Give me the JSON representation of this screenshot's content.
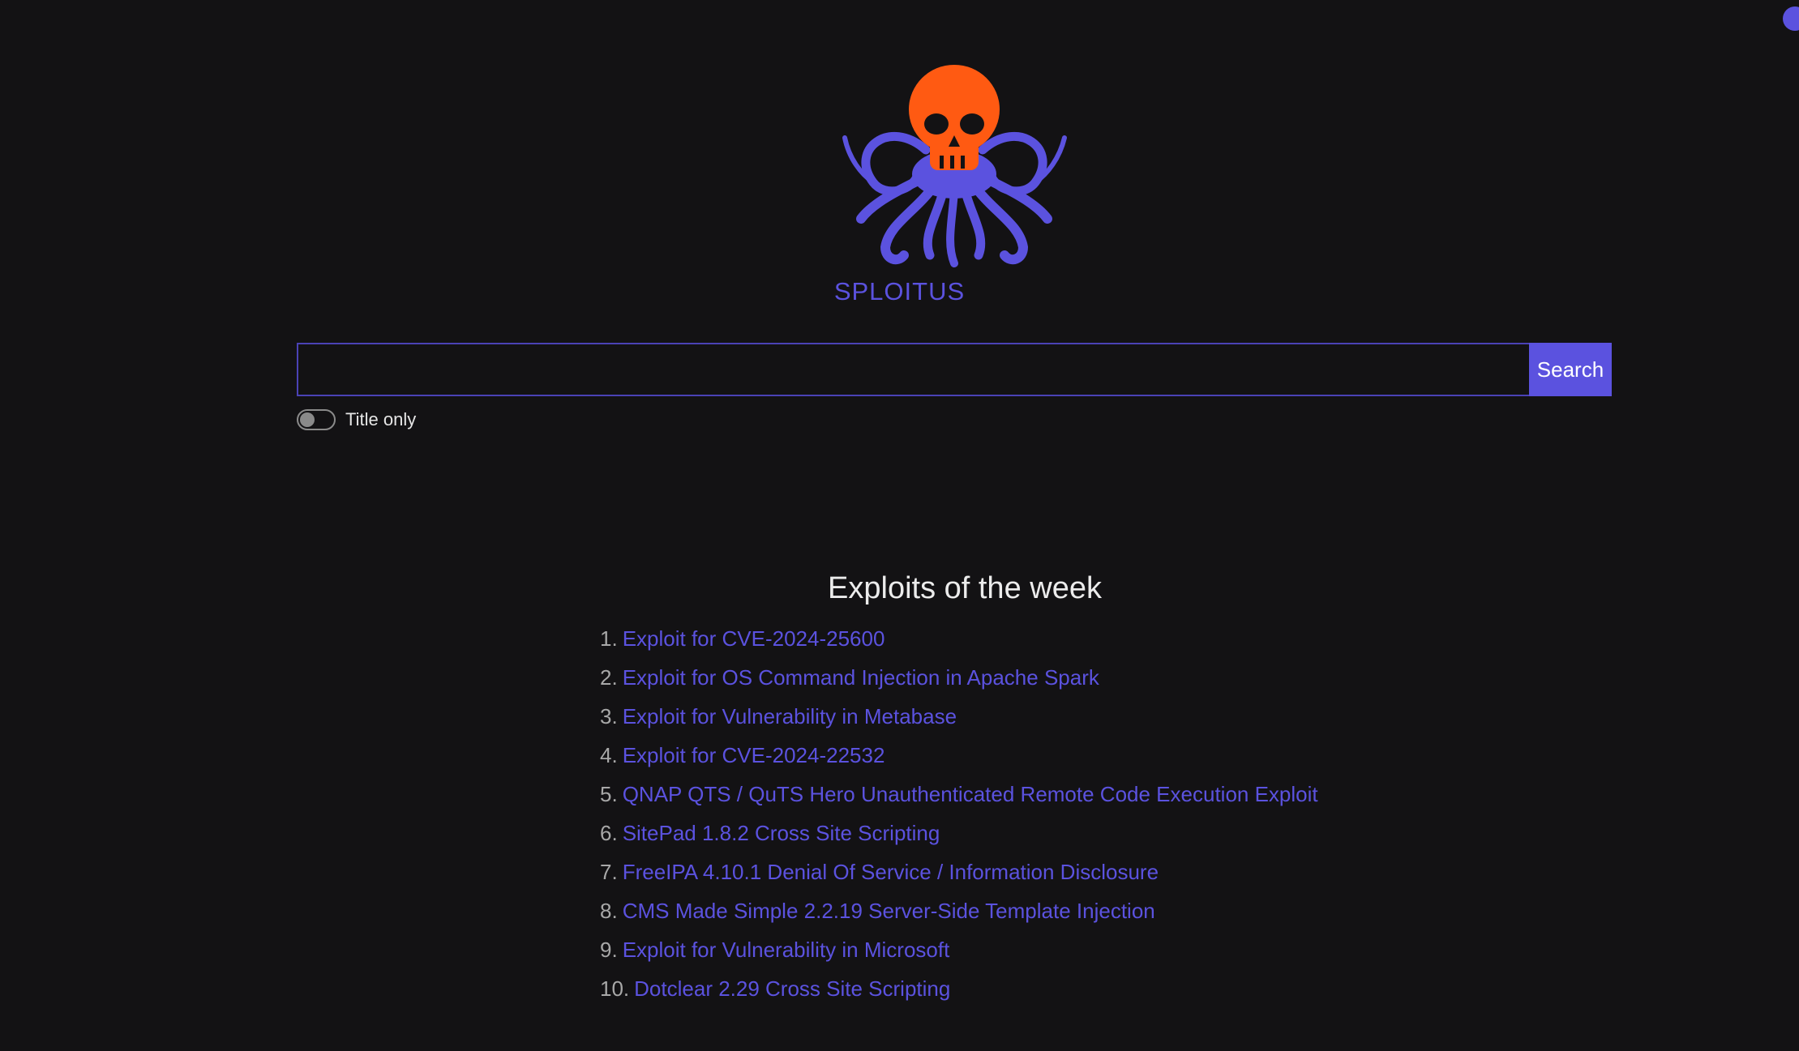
{
  "brand": {
    "name": "SPLOITUS",
    "accent_color": "#5b52df",
    "logo_skull_color": "#ff5a12",
    "logo_tentacle_color": "#5b52df"
  },
  "search": {
    "value": "",
    "placeholder": "",
    "button_label": "Search"
  },
  "toggle": {
    "label": "Title only",
    "checked": false
  },
  "week": {
    "title": "Exploits of the week",
    "items": [
      {
        "num": "1.",
        "label": "Exploit for CVE-2024-25600"
      },
      {
        "num": "2.",
        "label": "Exploit for OS Command Injection in Apache Spark"
      },
      {
        "num": "3.",
        "label": "Exploit for Vulnerability in Metabase"
      },
      {
        "num": "4.",
        "label": "Exploit for CVE-2024-22532"
      },
      {
        "num": "5.",
        "label": "QNAP QTS / QuTS Hero Unauthenticated Remote Code Execution Exploit"
      },
      {
        "num": "6.",
        "label": "SitePad 1.8.2 Cross Site Scripting"
      },
      {
        "num": "7.",
        "label": "FreeIPA 4.10.1 Denial Of Service / Information Disclosure"
      },
      {
        "num": "8.",
        "label": "CMS Made Simple 2.2.19 Server-Side Template Injection"
      },
      {
        "num": "9.",
        "label": "Exploit for Vulnerability in Microsoft"
      },
      {
        "num": "10.",
        "label": "Dotclear 2.29 Cross Site Scripting"
      }
    ]
  }
}
